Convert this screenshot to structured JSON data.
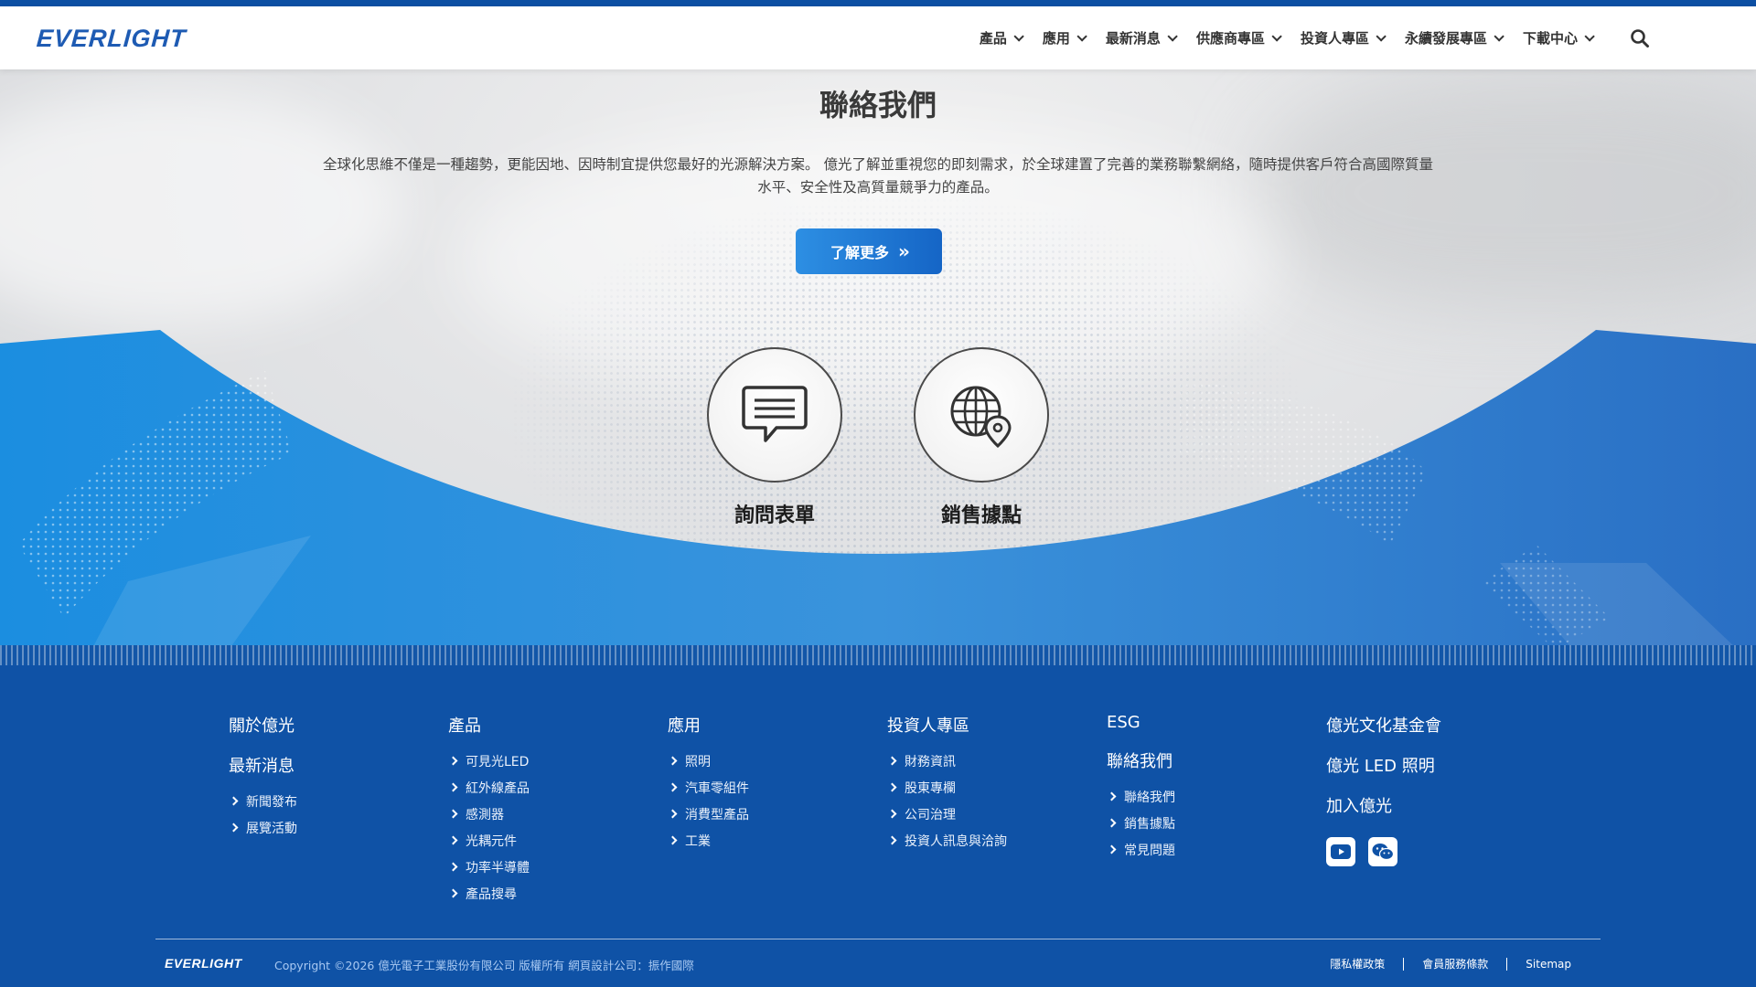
{
  "brand": {
    "logo": "EVERLIGHT",
    "accent": "#0f52a6",
    "button": "#1e74d4"
  },
  "nav": {
    "items": [
      "產品",
      "應用",
      "最新消息",
      "供應商專區",
      "投資人專區",
      "永續發展專區",
      "下載中心"
    ],
    "search_icon": "search-icon"
  },
  "hero": {
    "title": "聯絡我們",
    "description": "全球化思維不僅是一種趨勢，更能因地、因時制宜提供您最好的光源解決方案。 億光了解並重視您的即刻需求，於全球建置了完善的業務聯繫網絡，隨時提供客戶符合高國際質量水平、安全性及高質量競爭力的產品。",
    "button_label": "了解更多",
    "cards": [
      {
        "label": "詢問表單",
        "icon": "chat-icon"
      },
      {
        "label": "銷售據點",
        "icon": "globe-location-icon"
      }
    ]
  },
  "footer": {
    "columns": [
      {
        "groups": [
          {
            "heading": "關於億光",
            "links": []
          },
          {
            "heading": "最新消息",
            "links": [
              "新聞發布",
              "展覽活動"
            ]
          }
        ]
      },
      {
        "groups": [
          {
            "heading": "產品",
            "links": [
              "可見光LED",
              "紅外線產品",
              "感測器",
              "光耦元件",
              "功率半導體",
              "產品搜尋"
            ]
          }
        ]
      },
      {
        "groups": [
          {
            "heading": "應用",
            "links": [
              "照明",
              "汽車零組件",
              "消費型產品",
              "工業"
            ]
          }
        ]
      },
      {
        "groups": [
          {
            "heading": "投資人專區",
            "links": [
              "財務資訊",
              "股東專欄",
              "公司治理",
              "投資人訊息與洽詢"
            ]
          }
        ]
      },
      {
        "groups": [
          {
            "heading": "ESG",
            "links": []
          },
          {
            "heading": "聯絡我們",
            "links": [
              "聯絡我們",
              "銷售據點",
              "常見問題"
            ]
          }
        ]
      },
      {
        "groups": [
          {
            "heading": "億光文化基金會",
            "links": []
          },
          {
            "heading": "億光 LED 照明",
            "links": []
          },
          {
            "heading": "加入億光",
            "links": []
          }
        ]
      }
    ],
    "social": [
      "youtube-icon",
      "wechat-icon"
    ],
    "logo": "EVERLIGHT",
    "copyright": "Copyright ©2026 億光電子工業股份有限公司 版權所有 網頁設計公司：振作國際",
    "legal": [
      "隱私權政策",
      "會員服務條款",
      "Sitemap"
    ]
  }
}
